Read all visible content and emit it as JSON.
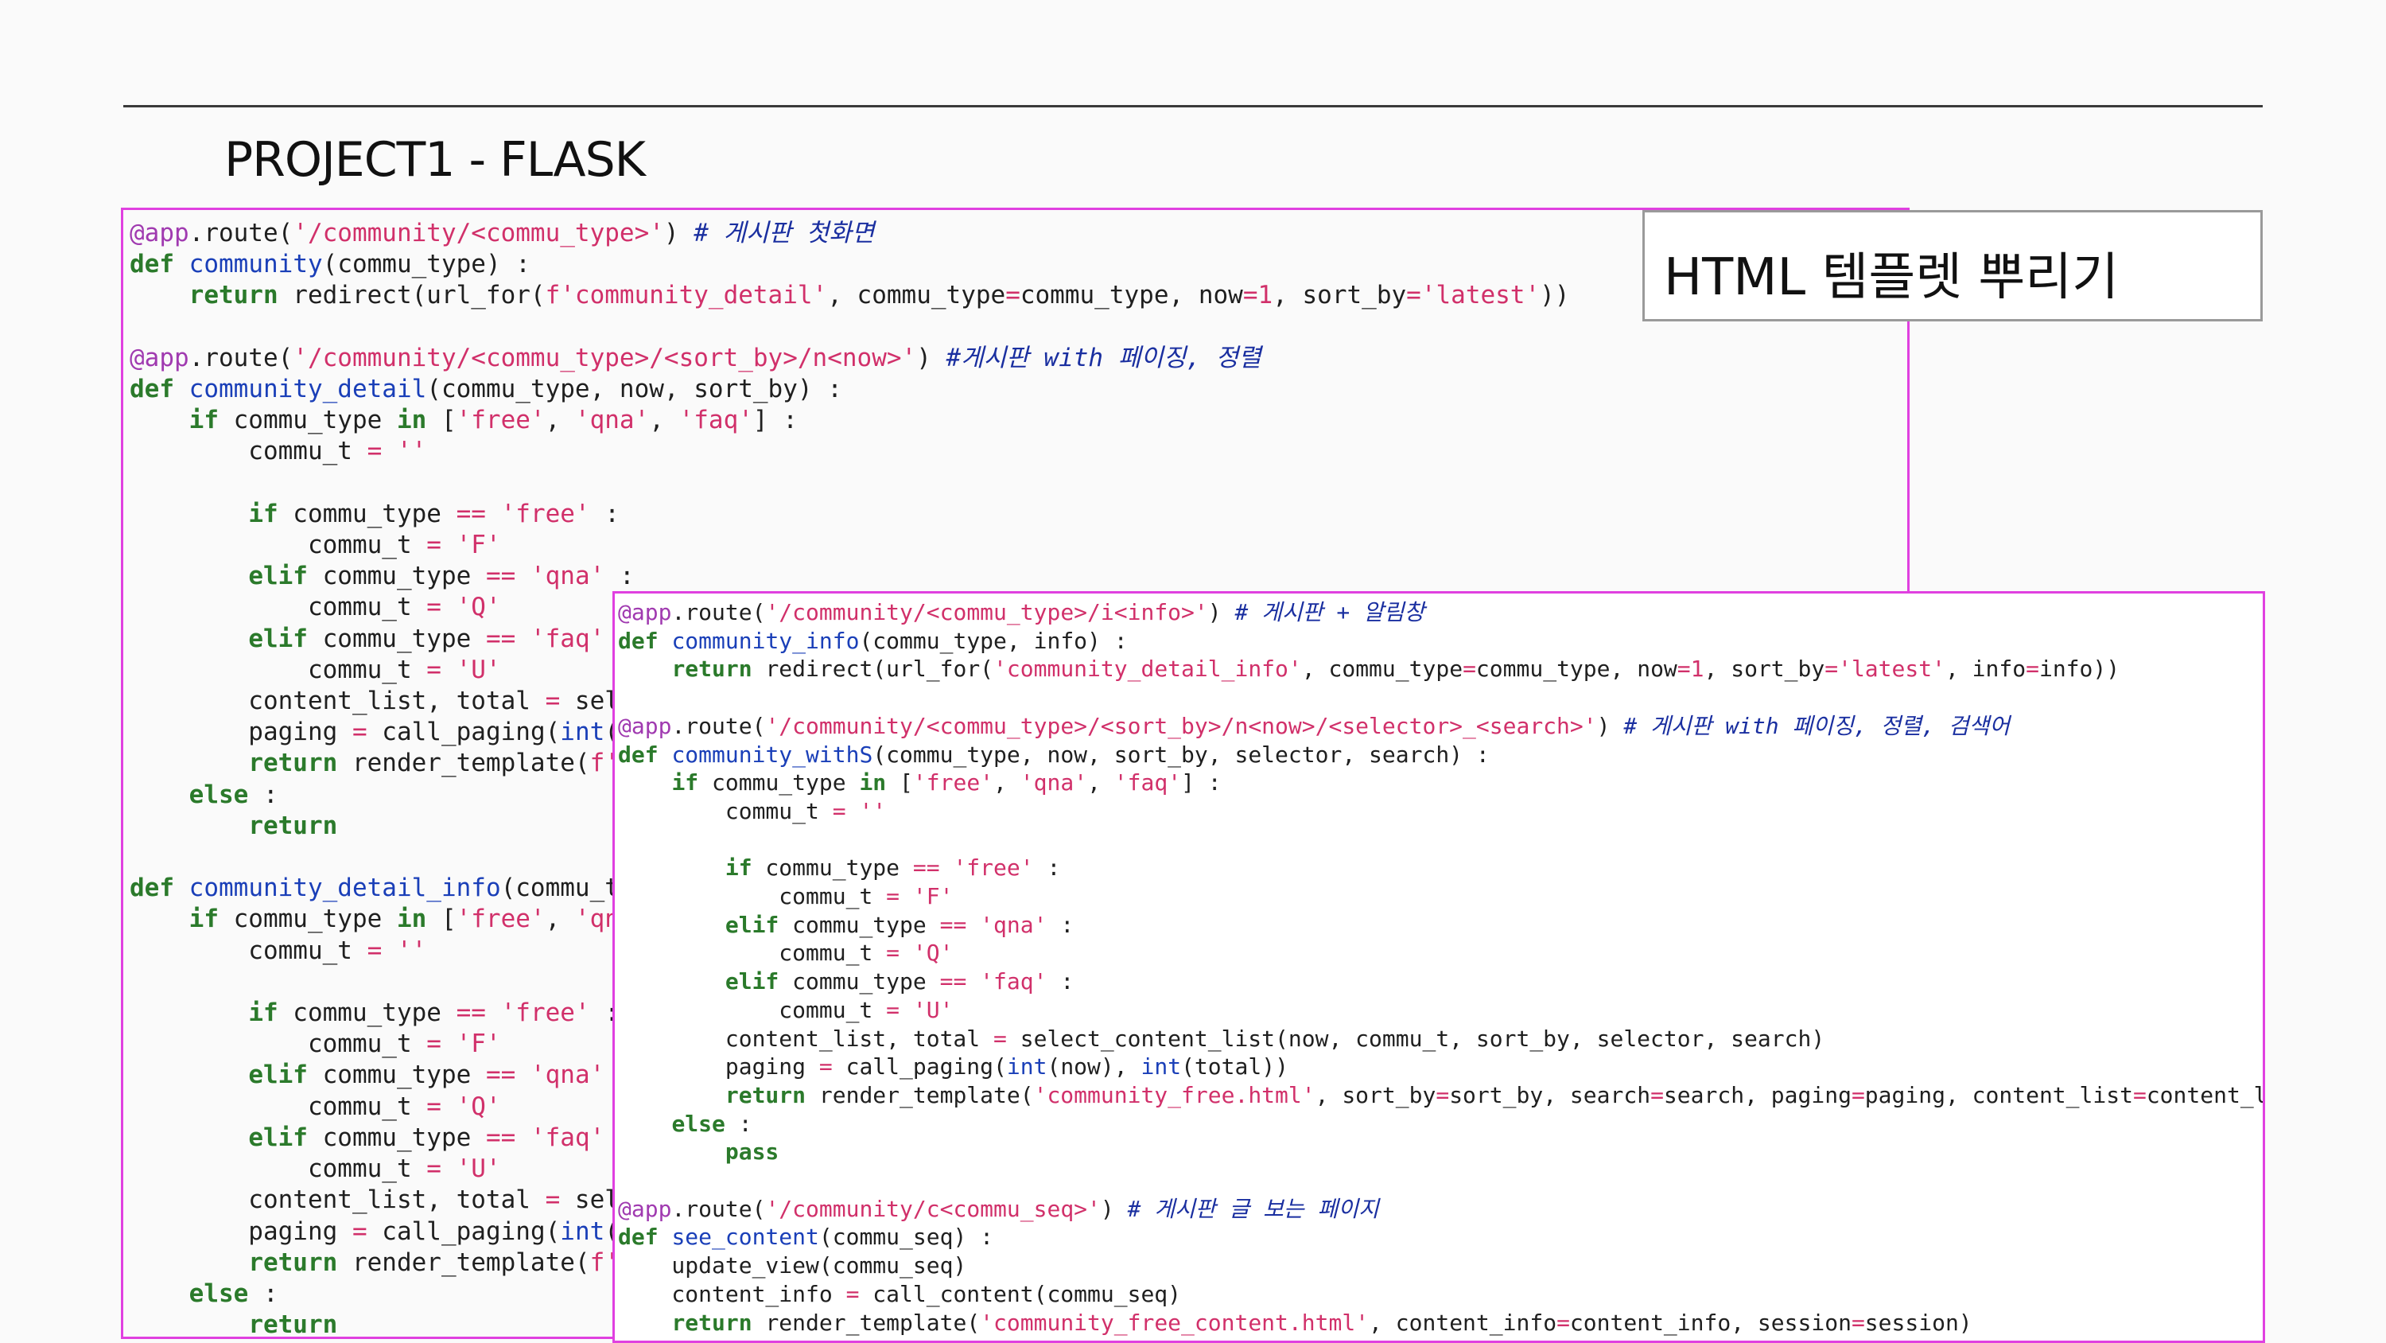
{
  "slide_title": "PROJECT1 - FLASK",
  "callout_label": "HTML 템플렛 뿌리기",
  "colors": {
    "panel_border": "#e040e0",
    "keyword": "#2b7a2b",
    "function": "#1a3fb8",
    "string": "#d1306a",
    "comment": "#1a2fa0",
    "decorator": "#a03ab0"
  },
  "code_left": [
    "@app.route('/community/<commu_type>') # 게시판 첫화면",
    "def community(commu_type) :",
    "    return redirect(url_for(f'community_detail', commu_type=commu_type, now=1, sort_by='latest'))",
    "",
    "@app.route('/community/<commu_type>/<sort_by>/n<now>') #게시판 with 페이징, 정렬",
    "def community_detail(commu_type, now, sort_by) :",
    "    if commu_type in ['free', 'qna', 'faq'] :",
    "        commu_t = ''",
    "",
    "        if commu_type == 'free' :",
    "            commu_t = 'F'",
    "        elif commu_type == 'qna' :",
    "            commu_t = 'Q'",
    "        elif commu_type == 'faq' :",
    "            commu_t = 'U'",
    "        content_list, total = sele",
    "        paging = call_paging(int(n",
    "        return render_template(f'",
    "    else :",
    "        return",
    "",
    "def community_detail_info(commu_ty",
    "    if commu_type in ['free', 'qna",
    "        commu_t = ''",
    "",
    "        if commu_type == 'free' :",
    "            commu_t = 'F'",
    "        elif commu_type == 'qna'",
    "            commu_t = 'Q'",
    "        elif commu_type == 'faq'",
    "            commu_t = 'U'",
    "        content_list, total = sele",
    "        paging = call_paging(int(n",
    "        return render_template(f'",
    "    else :",
    "        return"
  ],
  "code_right": [
    "@app.route('/community/<commu_type>/i<info>') # 게시판 + 알림창",
    "def community_info(commu_type, info) :",
    "    return redirect(url_for('community_detail_info', commu_type=commu_type, now=1, sort_by='latest', info=info))",
    "",
    "@app.route('/community/<commu_type>/<sort_by>/n<now>/<selector>_<search>') # 게시판 with 페이징, 정렬, 검색어",
    "def community_withS(commu_type, now, sort_by, selector, search) :",
    "    if commu_type in ['free', 'qna', 'faq'] :",
    "        commu_t = ''",
    "",
    "        if commu_type == 'free' :",
    "            commu_t = 'F'",
    "        elif commu_type == 'qna' :",
    "            commu_t = 'Q'",
    "        elif commu_type == 'faq' :",
    "            commu_t = 'U'",
    "        content_list, total = select_content_list(now, commu_t, sort_by, selector, search)",
    "        paging = call_paging(int(now), int(total))",
    "        return render_template('community_free.html', sort_by=sort_by, search=search, paging=paging, content_list=content_li",
    "    else :",
    "        pass",
    "",
    "@app.route('/community/c<commu_seq>') # 게시판 글 보는 페이지",
    "def see_content(commu_seq) :",
    "    update_view(commu_seq)",
    "    content_info = call_content(commu_seq)",
    "    return render_template('community_free_content.html', content_info=content_info, session=session)"
  ]
}
